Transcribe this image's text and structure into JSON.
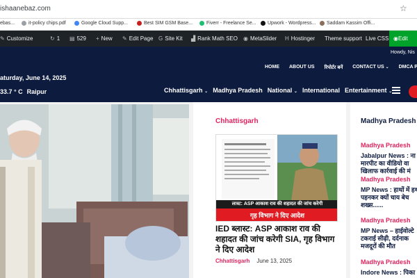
{
  "browser": {
    "url": "ishaanebaz.com",
    "bookmark_star": "☆"
  },
  "bookmarks": [
    {
      "label": "ebas..."
    },
    {
      "label": "it-policy chips.pdf"
    },
    {
      "label": "Google Cloud Supp..."
    },
    {
      "label": "Best SIM GSM Base..."
    },
    {
      "label": "Fiverr - Freelance Se..."
    },
    {
      "label": "Upwork - Wordpress..."
    },
    {
      "label": "Saddam Kassim Offi..."
    }
  ],
  "adminbar": {
    "customize": "Customize",
    "updates_count": "1",
    "comments_count": "529",
    "new": "New",
    "edit_page": "Edit Page",
    "site_kit": "Site Kit",
    "rank_math": "Rank Math SEO",
    "metaslider": "MetaSlider",
    "hostinger": "Hostinger",
    "theme_support": "Theme support",
    "live_css": "Live CSS",
    "edit": "Edit"
  },
  "header": {
    "howdy": "Howdy, Nis",
    "date": "aturday, June 14, 2025",
    "temperature": "33.7 ° C",
    "temperature_prefix": "3",
    "city": "Raipur",
    "top_nav": [
      "HOME",
      "ABOUT US",
      "रिपोर्टर बनें",
      "CONTACT US",
      "DMCA POLICY"
    ],
    "categories": [
      {
        "label": "Chhattisgarh",
        "dropdown": true
      },
      {
        "label": "Madhya Pradesh",
        "dropdown": false
      },
      {
        "label": "National",
        "dropdown": true
      },
      {
        "label": "International",
        "dropdown": false
      },
      {
        "label": "Entertainment",
        "dropdown": true
      }
    ]
  },
  "featured": {
    "category": "Chhattisgarh",
    "image_caption_top": "लास्ट: ASP आकाश राव की शहादत की जांच करेगी",
    "image_caption_bottom": "गृह विभाग ने दिए आदेश",
    "title": "IED ब्लास्ट: ASP आकाश राव की शहादत की जांच करेगी SIA, गृह विभाग ने दिए आदेश",
    "meta_category": "Chhattisgarh",
    "meta_date": "June 13, 2025"
  },
  "sidebar": {
    "heading": "Madhya Pradesh",
    "items": [
      {
        "category": "Madhya Pradesh",
        "title1": "Jabalpur News : ना",
        "title2": "मारपीट का वीडियो वा",
        "title3": "खिलाफ कार्रवाई की मं"
      },
      {
        "category": "Madhya Pradesh",
        "title1": "MP News : हाथों में हथ",
        "title2": "पहनकर क्यों चाय बेच",
        "title3": "शख्स......"
      },
      {
        "category": "Madhya Pradesh",
        "title1": "MP News – हाईवोल्टे",
        "title2": "टकराई सीढ़ी, दर्दनाक",
        "title3": "मजदूरों की मौत"
      },
      {
        "category": "Madhya Pradesh",
        "title1": "Indore News : पिका",
        "title2": "",
        "title3": ""
      }
    ]
  },
  "colors": {
    "header_bg": "#0d1b3e",
    "accent_pink": "#e0245e",
    "admin_bar": "#1d2327",
    "edit_green": "#00a32a"
  }
}
